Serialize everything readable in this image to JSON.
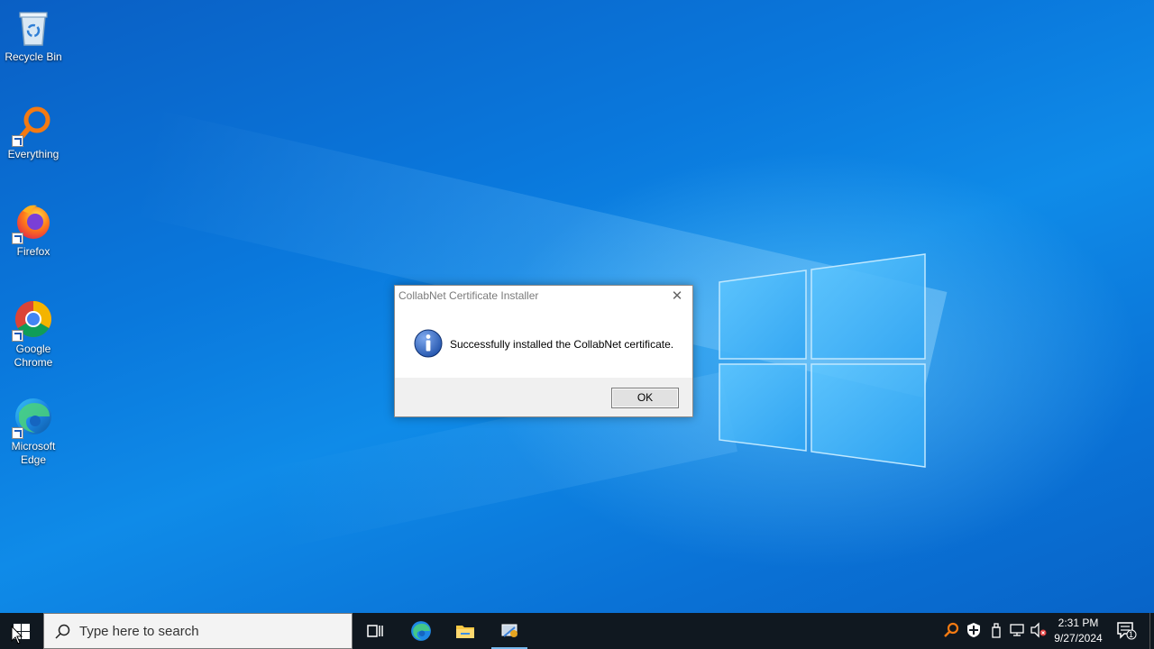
{
  "desktop": {
    "icons": [
      {
        "label": "Recycle Bin",
        "icon": "recycle-bin-icon"
      },
      {
        "label": "Everything",
        "icon": "everything-search-icon"
      },
      {
        "label": "Firefox",
        "icon": "firefox-icon"
      },
      {
        "label": "Google Chrome",
        "icon": "chrome-icon"
      },
      {
        "label": "Microsoft Edge",
        "icon": "edge-icon"
      }
    ]
  },
  "dialog": {
    "title": "CollabNet Certificate Installer",
    "close_glyph": "✕",
    "icon": "information-icon",
    "message": "Successfully installed the CollabNet certificate.",
    "ok_label": "OK"
  },
  "taskbar": {
    "search_placeholder": "Type here to search",
    "apps": [
      "task-view-icon",
      "edge-icon",
      "file-explorer-icon",
      "certificate-installer-icon"
    ],
    "tray_icons": [
      "everything-tray-icon",
      "defender-shield-icon",
      "usb-icon",
      "network-icon",
      "volume-muted-icon"
    ],
    "time": "2:31 PM",
    "date": "9/27/2024",
    "notification_count": "1"
  },
  "colors": {
    "desktop_blue": "#0a78dc",
    "taskbar": "#101820",
    "dialog_footer": "#f0f0f0",
    "info_blue": "#1d4fa8"
  }
}
